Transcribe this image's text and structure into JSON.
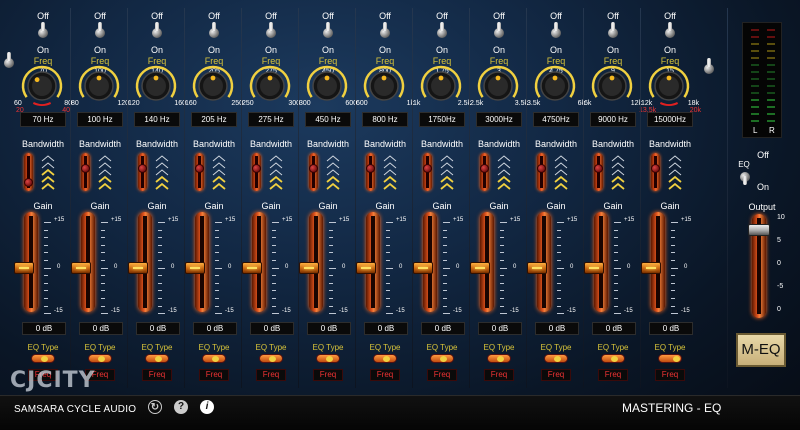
{
  "labels": {
    "off": "Off",
    "on": "On",
    "freq": "Freq",
    "bandwidth": "Bandwidth",
    "gain": "Gain",
    "eq_type": "EQ Type",
    "freq_button": "Freq",
    "eq": "EQ",
    "output": "Output"
  },
  "gain_scale": {
    "top": "+15",
    "mid": "0",
    "bot": "-15"
  },
  "output_scale": [
    "10",
    "5",
    "0",
    "-5",
    "0"
  ],
  "bands": [
    {
      "knob_min": "60",
      "knob_max": "70",
      "knob_high": "80",
      "freq": "70  Hz",
      "gain": "0  dB",
      "value": 0.35,
      "extra_min": "20",
      "extra_max": "40"
    },
    {
      "knob_min": "80",
      "knob_max": "100",
      "knob_high": "120",
      "freq": "100 Hz",
      "gain": "0  dB",
      "value": 0.5
    },
    {
      "knob_min": "120",
      "knob_max": "140",
      "knob_high": "160",
      "freq": "140 Hz",
      "gain": "0  dB",
      "value": 0.5
    },
    {
      "knob_min": "160",
      "knob_max": "205",
      "knob_high": "250",
      "freq": "205 Hz",
      "gain": "0  dB",
      "value": 0.5
    },
    {
      "knob_min": "250",
      "knob_max": "275",
      "knob_high": "300",
      "freq": "275 Hz",
      "gain": "0  dB",
      "value": 0.5
    },
    {
      "knob_min": "300",
      "knob_max": "450",
      "knob_high": "600",
      "freq": "450 Hz",
      "gain": "0  dB",
      "value": 0.5
    },
    {
      "knob_min": "600",
      "knob_max": "800",
      "knob_high": "1k",
      "freq": "800 Hz",
      "gain": "0  dB",
      "value": 0.5
    },
    {
      "knob_min": "1k",
      "knob_max": "1.75",
      "knob_high": "2.5k",
      "freq": "1750Hz",
      "gain": "0  dB",
      "value": 0.5
    },
    {
      "knob_min": "2.5k",
      "knob_max": "3",
      "knob_high": "3.5k",
      "freq": "3000Hz",
      "gain": "0  dB",
      "value": 0.5
    },
    {
      "knob_min": "3.5k",
      "knob_max": "4.75",
      "knob_high": "6k",
      "freq": "4750Hz",
      "gain": "0  dB",
      "value": 0.5
    },
    {
      "knob_min": "6k",
      "knob_max": "9",
      "knob_high": "12k",
      "freq": "9000 Hz",
      "gain": "0  dB",
      "value": 0.5
    },
    {
      "knob_min": "12k",
      "knob_max": "15",
      "knob_high": "18k",
      "freq": "15000Hz",
      "gain": "0  dB",
      "value": 0.5,
      "extra_min": "13.5k",
      "extra_max": "20k"
    }
  ],
  "meter": {
    "left": "L",
    "right": "R"
  },
  "meq_label": "M-EQ",
  "footer": {
    "brand": "SAMSARA CYCLE AUDIO",
    "product": "MASTERING - EQ",
    "logo_text": "CJCITY"
  },
  "colors": {
    "accent": "#d6c23a",
    "slider": "#e2541e",
    "knob_ring": "#f0d040"
  }
}
